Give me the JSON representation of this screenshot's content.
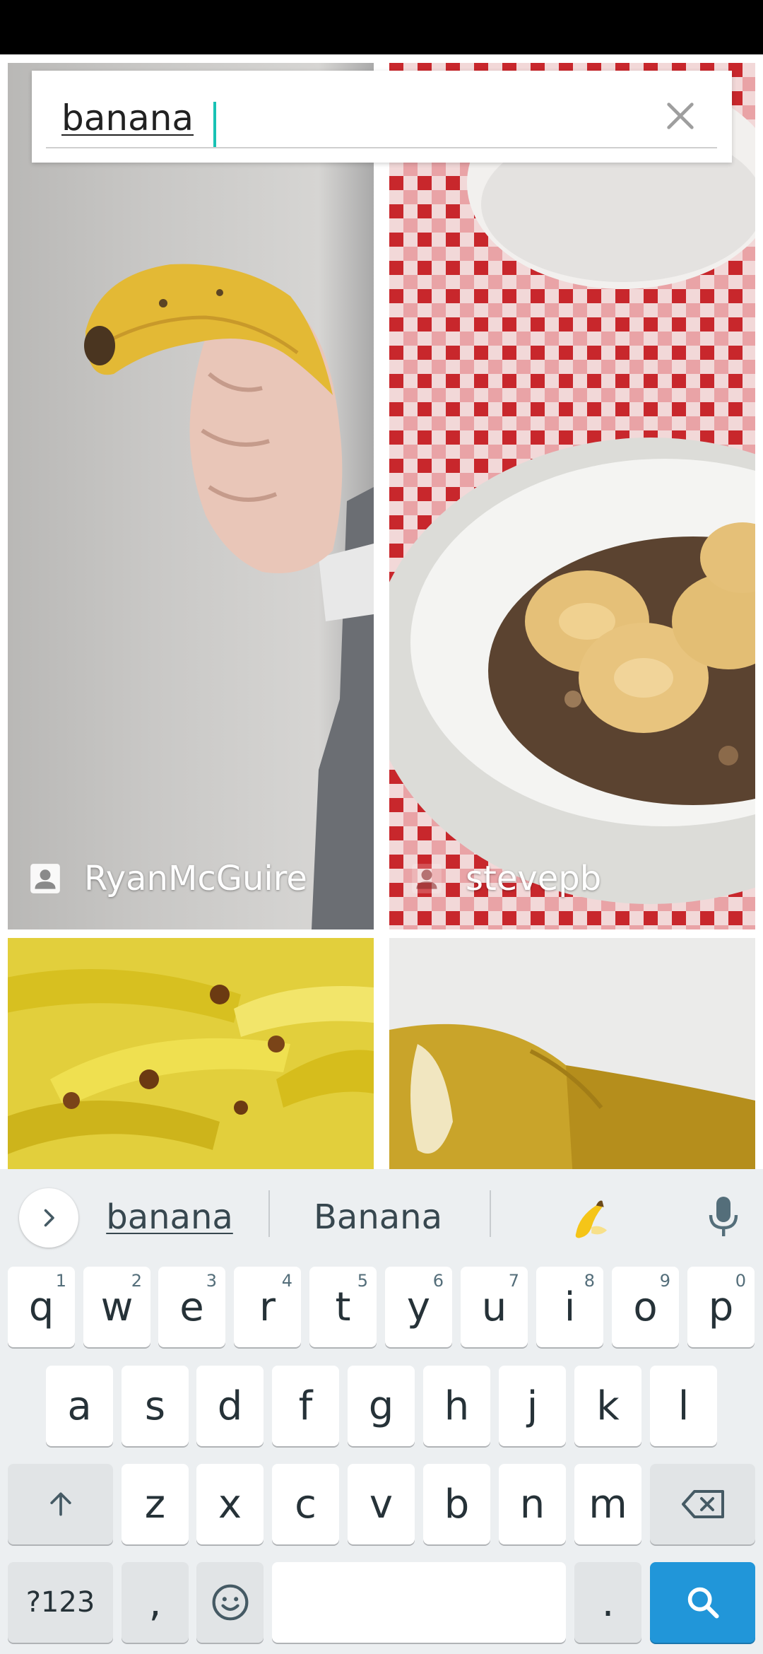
{
  "search": {
    "query": "banana"
  },
  "results": [
    {
      "author": "RyanMcGuire"
    },
    {
      "author": "stevepb"
    }
  ],
  "keyboard": {
    "suggestions": [
      "banana",
      "Banana"
    ],
    "emoji_suggestion": "banana-emoji",
    "row1": [
      {
        "key": "q",
        "hint": "1"
      },
      {
        "key": "w",
        "hint": "2"
      },
      {
        "key": "e",
        "hint": "3"
      },
      {
        "key": "r",
        "hint": "4"
      },
      {
        "key": "t",
        "hint": "5"
      },
      {
        "key": "y",
        "hint": "6"
      },
      {
        "key": "u",
        "hint": "7"
      },
      {
        "key": "i",
        "hint": "8"
      },
      {
        "key": "o",
        "hint": "9"
      },
      {
        "key": "p",
        "hint": "0"
      }
    ],
    "row2": [
      "a",
      "s",
      "d",
      "f",
      "g",
      "h",
      "j",
      "k",
      "l"
    ],
    "row3": [
      "z",
      "x",
      "c",
      "v",
      "b",
      "n",
      "m"
    ],
    "symbols_label": "?123",
    "comma_label": ",",
    "period_label": "."
  },
  "colors": {
    "accent": "#19c2b4",
    "search_key": "#2196d9"
  }
}
